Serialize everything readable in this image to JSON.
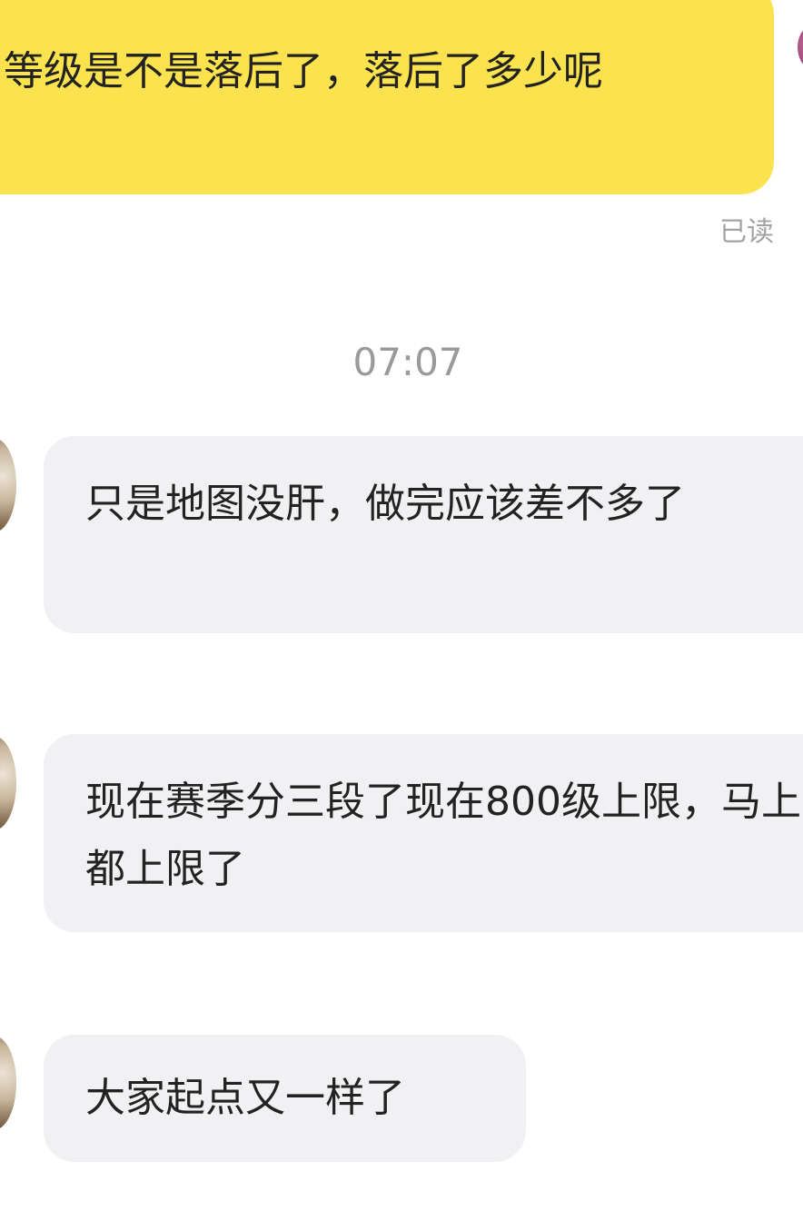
{
  "conversation": {
    "outgoing": [
      {
        "text": "等级是不是落后了，落后了多少呢",
        "status": "已读"
      }
    ],
    "divider_time": "07:07",
    "incoming": [
      {
        "text": "只是地图没肝，做完应该差不多了"
      },
      {
        "text": "现在赛季分三段了现在800级上限，马上都上限了"
      },
      {
        "text": "大家起点又一样了"
      }
    ]
  },
  "colors": {
    "outgoing_bubble": "#fbe34f",
    "incoming_bubble": "#f1f1f3",
    "muted_text": "#9a9a9a"
  },
  "icons": {
    "self_avatar": "user-avatar-icon",
    "peer_avatar": "contact-avatar-icon"
  }
}
